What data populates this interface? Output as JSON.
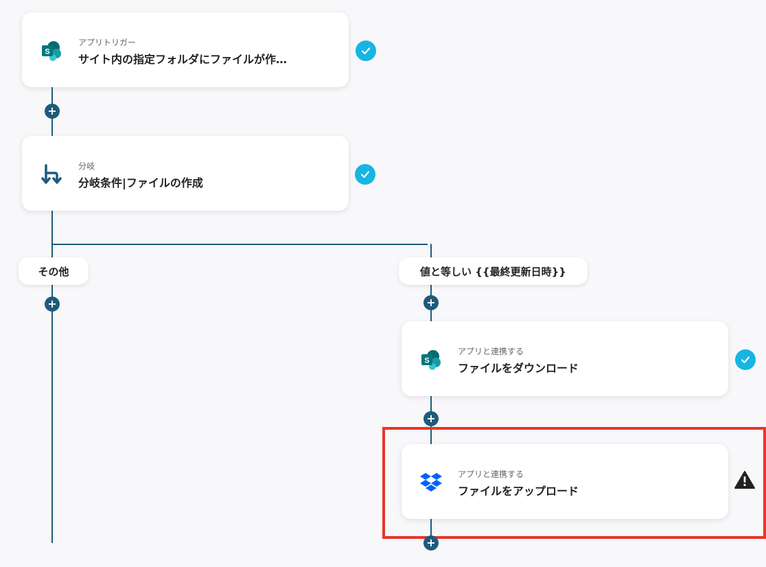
{
  "trigger": {
    "subtitle": "アプリトリガー",
    "title": "サイト内の指定フォルダにファイルが作…",
    "icon": "sharepoint-icon",
    "status": "complete"
  },
  "branch": {
    "subtitle": "分岐",
    "title": "分岐条件|ファイルの作成",
    "icon": "branch-icon",
    "status": "complete"
  },
  "branches": {
    "left_label": "その他",
    "right_label": "値と等しい {{最終更新日時}}"
  },
  "download_step": {
    "subtitle": "アプリと連携する",
    "title": "ファイルをダウンロード",
    "icon": "sharepoint-icon",
    "status": "complete"
  },
  "upload_step": {
    "subtitle": "アプリと連携する",
    "title": "ファイルをアップロード",
    "icon": "dropbox-icon",
    "status": "warning"
  },
  "colors": {
    "connector": "#1d5b7c",
    "check": "#16b5e2",
    "highlight": "#e8352a",
    "sharepoint": "#036c70",
    "dropbox": "#0061fe"
  }
}
